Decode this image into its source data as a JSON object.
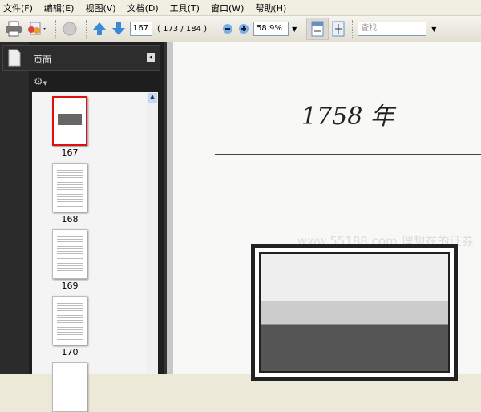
{
  "menu": [
    "文件(F)",
    "编辑(E)",
    "视图(V)",
    "文档(D)",
    "工具(T)",
    "窗口(W)",
    "帮助(H)"
  ],
  "toolbar": {
    "page_input": "167",
    "page_count": "( 173 / 184 )",
    "zoom": "58.9%",
    "find_placeholder": "查找"
  },
  "sidebar": {
    "title": "页面",
    "thumbnails": [
      {
        "label": "167",
        "selected": true
      },
      {
        "label": "168"
      },
      {
        "label": "169"
      },
      {
        "label": "170"
      }
    ]
  },
  "document": {
    "heading": "1758 年",
    "watermark": "www.55188.com 理想在的证券"
  },
  "colors": {
    "selection": "#e01010",
    "sidebar_bg": "#1e1e1e"
  }
}
